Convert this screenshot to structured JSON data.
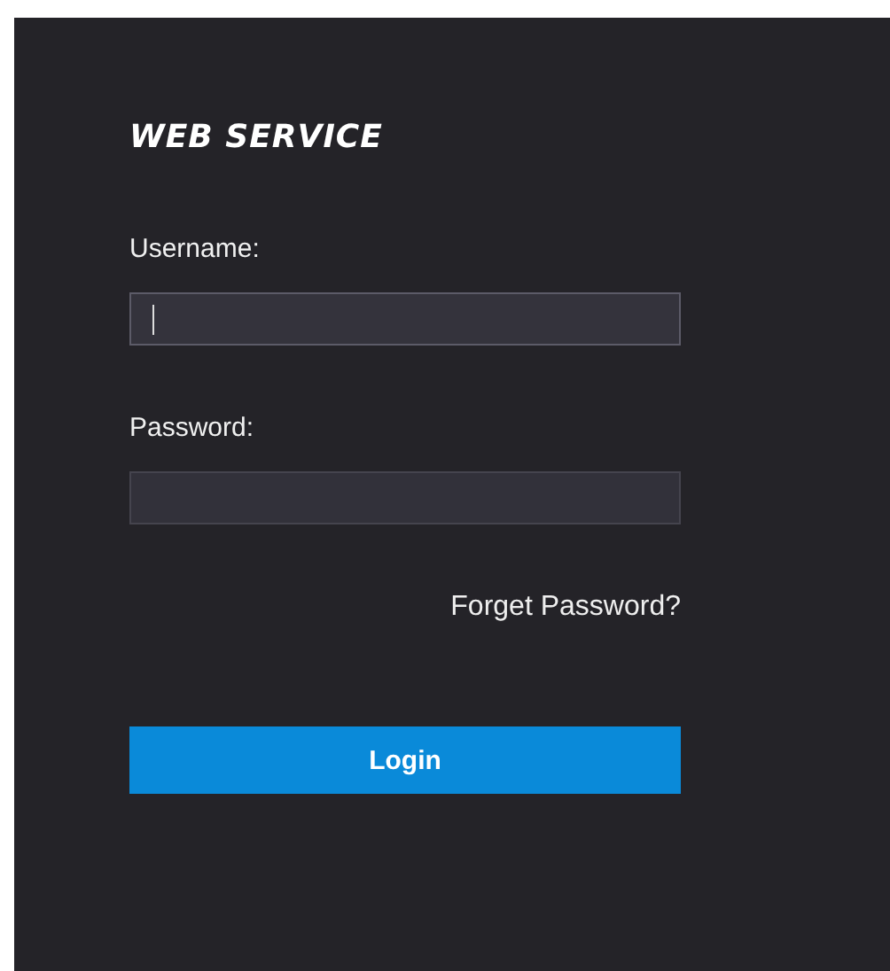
{
  "title": "WEB SERVICE",
  "fields": [
    {
      "label": "Username:",
      "focused": true
    },
    {
      "label": "Password:",
      "focused": false
    }
  ],
  "forgot_link": "Forget Password?",
  "login_button": "Login"
}
